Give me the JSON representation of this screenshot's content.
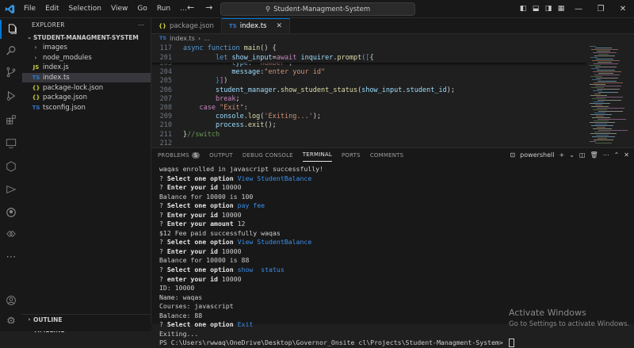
{
  "menu": [
    "File",
    "Edit",
    "Selection",
    "View",
    "Go",
    "Run",
    "…"
  ],
  "search": {
    "label": "Student-Managment-System"
  },
  "explorer": {
    "title": "EXPLORER",
    "folder": "STUDENT-MANAGMENT-SYSTEM",
    "items": [
      {
        "label": "images",
        "type": "folder"
      },
      {
        "label": "node_modules",
        "type": "folder"
      },
      {
        "label": "index.js",
        "type": "js"
      },
      {
        "label": "index.ts",
        "type": "ts"
      },
      {
        "label": "package-lock.json",
        "type": "json"
      },
      {
        "label": "package.json",
        "type": "json"
      },
      {
        "label": "tsconfig.json",
        "type": "tsconfig"
      }
    ],
    "outline": "OUTLINE",
    "timeline": "TIMELINE"
  },
  "tabs": [
    {
      "icon": "{}",
      "label": "package.json"
    },
    {
      "icon": "TS",
      "label": "index.ts"
    }
  ],
  "breadcrumb": {
    "file": "index.ts",
    "rest": "..."
  },
  "code": {
    "sticky": [
      {
        "ln": "117",
        "parts": [
          [
            "kw",
            "async "
          ],
          [
            "kw",
            "function "
          ],
          [
            "fn",
            "main"
          ],
          [
            "pl",
            "() {"
          ]
        ]
      },
      {
        "ln": "201",
        "parts": [
          [
            "pl",
            "        "
          ],
          [
            "kw",
            "let "
          ],
          [
            "var",
            "show_input"
          ],
          [
            "pl",
            "="
          ],
          [
            "kw2",
            "await "
          ],
          [
            "var",
            "inquirer"
          ],
          [
            "pl",
            "."
          ],
          [
            "fn",
            "prompt"
          ],
          [
            "br",
            "("
          ],
          [
            "br2",
            "["
          ],
          [
            "pl",
            "{"
          ]
        ]
      }
    ],
    "lines": [
      {
        "ln": "203",
        "parts": [
          [
            "pl",
            "            "
          ],
          [
            "var",
            "type"
          ],
          [
            "pl",
            ": "
          ],
          [
            "str",
            "\"number\""
          ],
          [
            "pl",
            ","
          ]
        ]
      },
      {
        "ln": "204",
        "parts": [
          [
            "pl",
            "            "
          ],
          [
            "var",
            "message"
          ],
          [
            "pl",
            ":"
          ],
          [
            "str",
            "\"enter your id\""
          ]
        ]
      },
      {
        "ln": "205",
        "parts": [
          [
            "pl",
            "        "
          ],
          [
            "br2",
            "}"
          ],
          [
            "br",
            "]"
          ],
          [
            "pl",
            ")"
          ]
        ]
      },
      {
        "ln": "206",
        "parts": [
          [
            "pl",
            "        "
          ],
          [
            "var",
            "student_manager"
          ],
          [
            "pl",
            "."
          ],
          [
            "fn",
            "show_student_status"
          ],
          [
            "pl",
            "("
          ],
          [
            "var",
            "show_input"
          ],
          [
            "pl",
            "."
          ],
          [
            "var",
            "student_id"
          ],
          [
            "pl",
            ");"
          ]
        ]
      },
      {
        "ln": "207",
        "parts": [
          [
            "pl",
            "        "
          ],
          [
            "kw2",
            "break"
          ],
          [
            "pl",
            ";"
          ]
        ]
      },
      {
        "ln": "208",
        "parts": [
          [
            "pl",
            "    "
          ],
          [
            "kw2",
            "case "
          ],
          [
            "str",
            "\"Exit\""
          ],
          [
            "pl",
            ":"
          ]
        ]
      },
      {
        "ln": "209",
        "parts": [
          [
            "pl",
            "        "
          ],
          [
            "var",
            "console"
          ],
          [
            "pl",
            "."
          ],
          [
            "fn",
            "log"
          ],
          [
            "pl",
            "("
          ],
          [
            "str",
            "'Exiting...'"
          ],
          [
            "pl",
            ");"
          ]
        ]
      },
      {
        "ln": "210",
        "parts": [
          [
            "pl",
            "        "
          ],
          [
            "var",
            "process"
          ],
          [
            "pl",
            "."
          ],
          [
            "fn",
            "exit"
          ],
          [
            "pl",
            "();"
          ]
        ]
      },
      {
        "ln": "211",
        "parts": [
          [
            "pl",
            "}"
          ],
          [
            "cmt",
            "//switch"
          ]
        ]
      },
      {
        "ln": "212",
        "parts": []
      }
    ]
  },
  "panel": {
    "tabs": [
      "PROBLEMS",
      "OUTPUT",
      "DEBUG CONSOLE",
      "TERMINAL",
      "PORTS",
      "COMMENTS"
    ],
    "problems_count": "5",
    "shell": "powershell",
    "terminal": [
      [
        [
          "tq",
          "waqas enrolled in javascript successfully!"
        ]
      ],
      [
        [
          "tq",
          "? "
        ],
        [
          "tb",
          "Select one option "
        ],
        [
          "tc",
          "View StudentBalance"
        ]
      ],
      [
        [
          "tq",
          "? "
        ],
        [
          "tb",
          "Enter your id "
        ],
        [
          "tq",
          "10000"
        ]
      ],
      [
        [
          "tq",
          "Balance for 10000 is 100"
        ]
      ],
      [
        [
          "tq",
          "? "
        ],
        [
          "tb",
          "Select one option "
        ],
        [
          "tc",
          "pay fee"
        ]
      ],
      [
        [
          "tq",
          "? "
        ],
        [
          "tb",
          "Enter your id "
        ],
        [
          "tq",
          "10000"
        ]
      ],
      [
        [
          "tq",
          "? "
        ],
        [
          "tb",
          "Enter your amount "
        ],
        [
          "tq",
          "12"
        ]
      ],
      [
        [
          "tq",
          "$12 Fee paid successfully waqas"
        ]
      ],
      [
        [
          "tq",
          "? "
        ],
        [
          "tb",
          "Select one option "
        ],
        [
          "tc",
          "View StudentBalance"
        ]
      ],
      [
        [
          "tq",
          "? "
        ],
        [
          "tb",
          "Enter your id "
        ],
        [
          "tq",
          "10000"
        ]
      ],
      [
        [
          "tq",
          "Balance for 10000 is 88"
        ]
      ],
      [
        [
          "tq",
          "? "
        ],
        [
          "tb",
          "Select one option "
        ],
        [
          "tc",
          "show  status"
        ]
      ],
      [
        [
          "tq",
          "? "
        ],
        [
          "tb",
          "enter your id "
        ],
        [
          "tq",
          "10000"
        ]
      ],
      [
        [
          "tq",
          "ID: 10000"
        ]
      ],
      [
        [
          "tq",
          "Name: waqas"
        ]
      ],
      [
        [
          "tq",
          "Courses: javascript"
        ]
      ],
      [
        [
          "tq",
          "Balance: 88"
        ]
      ],
      [
        [
          "tq",
          "? "
        ],
        [
          "tb",
          "Select one option "
        ],
        [
          "tc",
          "Exit"
        ]
      ],
      [
        [
          "tq",
          "Exiting..."
        ]
      ],
      [
        [
          "tq",
          "PS C:\\Users\\rwwaq\\OneDrive\\Desktop\\Governor_Onsite cl\\Projects\\Student-Managment-System> "
        ]
      ]
    ]
  },
  "watermark": {
    "title": "Activate Windows",
    "sub": "Go to Settings to activate Windows."
  },
  "colors": {
    "accent": "#0078d4",
    "terminal_option": "#3b8eea"
  }
}
